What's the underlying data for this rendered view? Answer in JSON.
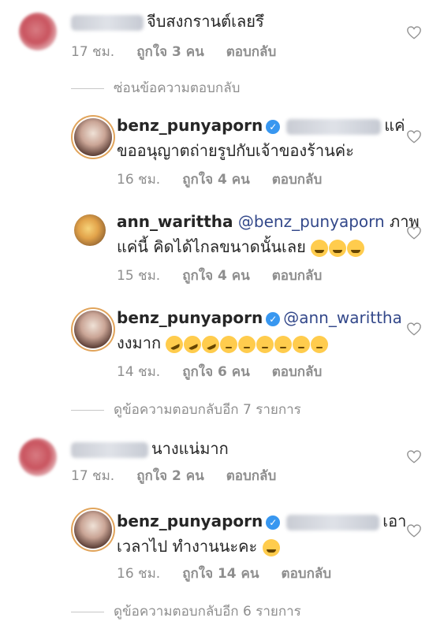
{
  "comments": [
    {
      "text": "จีบสงกรานต์เลยรึ",
      "time": "17 ชม.",
      "likes": "ถูกใจ 3 คน",
      "reply": "ตอบกลับ"
    },
    {
      "hide_replies": "ซ่อนข้อความตอบกลับ"
    },
    {
      "username": "benz_punyaporn",
      "text_a": "แค่",
      "text_b": "ขออนุญาตถ่ายรูปกับเจ้าของร้านค่ะ",
      "time": "16 ชม.",
      "likes": "ถูกใจ 4 คน",
      "reply": "ตอบกลับ"
    },
    {
      "username": "ann_warittha",
      "mention": "@benz_punyaporn",
      "text_a": "ภาพ",
      "text_b": "แค่นี้ คิดได้ไกลขนาดนั้นเลย",
      "time": "15 ชม.",
      "likes": "ถูกใจ 4 คน",
      "reply": "ตอบกลับ"
    },
    {
      "username": "benz_punyaporn",
      "mention": "@ann_warittha",
      "text_b": "งงมาก",
      "time": "14 ชม.",
      "likes": "ถูกใจ 6 คน",
      "reply": "ตอบกลับ"
    },
    {
      "view_more": "ดูข้อความตอบกลับอีก 7 รายการ"
    },
    {
      "text": "นางแน่มาก",
      "time": "17 ชม.",
      "likes": "ถูกใจ 2 คน",
      "reply": "ตอบกลับ"
    },
    {
      "username": "benz_punyaporn",
      "text_a": "เอา",
      "text_b": "เวลาไป ทำงานนะคะ",
      "time": "16 ชม.",
      "likes": "ถูกใจ 14 คน",
      "reply": "ตอบกลับ"
    },
    {
      "view_more": "ดูข้อความตอบกลับอีก 6 รายการ"
    }
  ],
  "icons": {
    "heart": "heart-outline-icon",
    "verified": "verified-badge-icon",
    "emoji_grin": "grinning-squinting-face-icon",
    "emoji_rofl": "rolling-on-floor-laughing-icon",
    "emoji_pensive": "pensive-face-icon",
    "emoji_hug": "hugging-face-icon"
  },
  "colors": {
    "mention": "#33488a",
    "meta": "#8e8e8e",
    "verified": "#3897f0"
  }
}
